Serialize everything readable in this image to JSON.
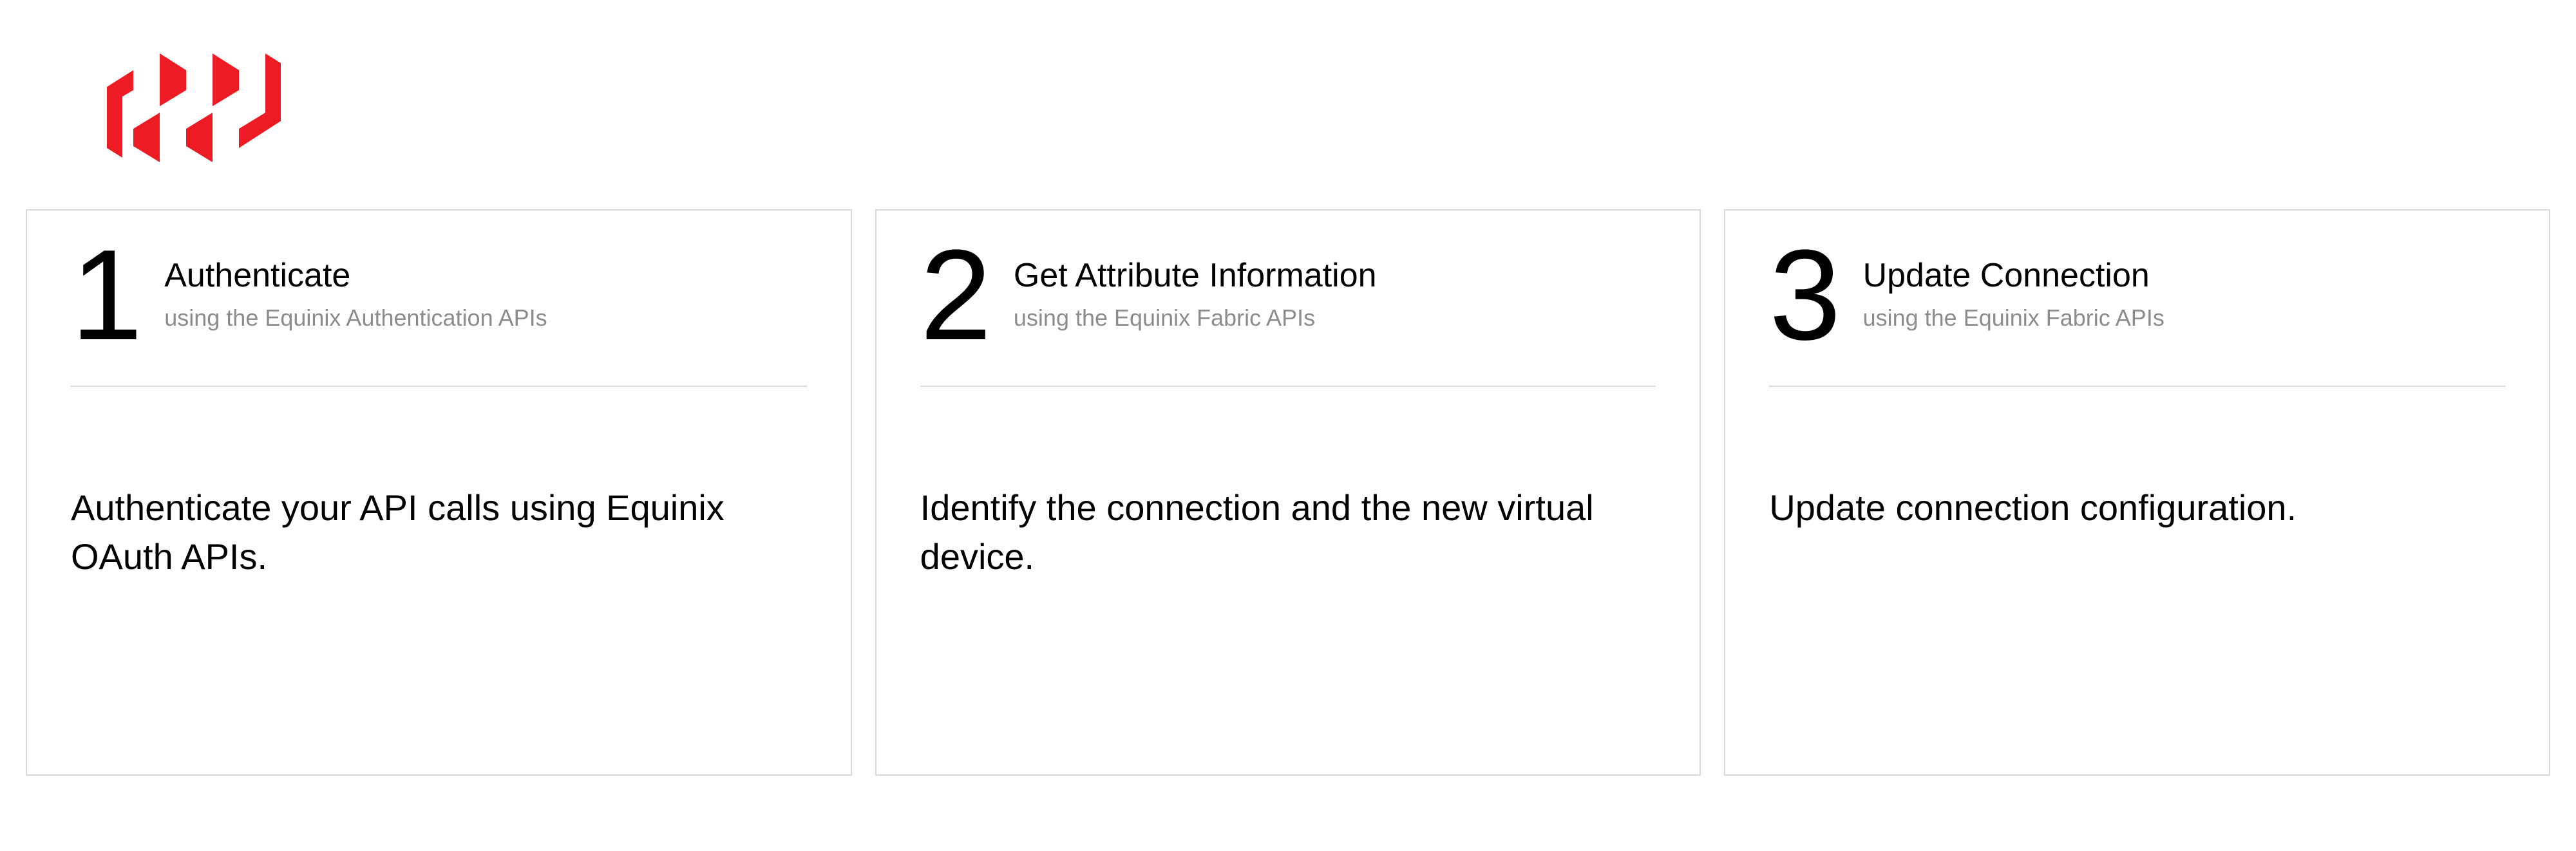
{
  "brand": {
    "color": "#ED1C24"
  },
  "steps": [
    {
      "number": "1",
      "title": "Authenticate",
      "subtitle": "using the Equinix Authentication APIs",
      "body": "Authenticate your API calls using Equinix OAuth APIs."
    },
    {
      "number": "2",
      "title": "Get Attribute Information",
      "subtitle": "using the Equinix Fabric APIs",
      "body": "Identify the connection and the new virtual device."
    },
    {
      "number": "3",
      "title": "Update Connection",
      "subtitle": "using the Equinix Fabric APIs",
      "body": "Update connection configuration."
    }
  ]
}
